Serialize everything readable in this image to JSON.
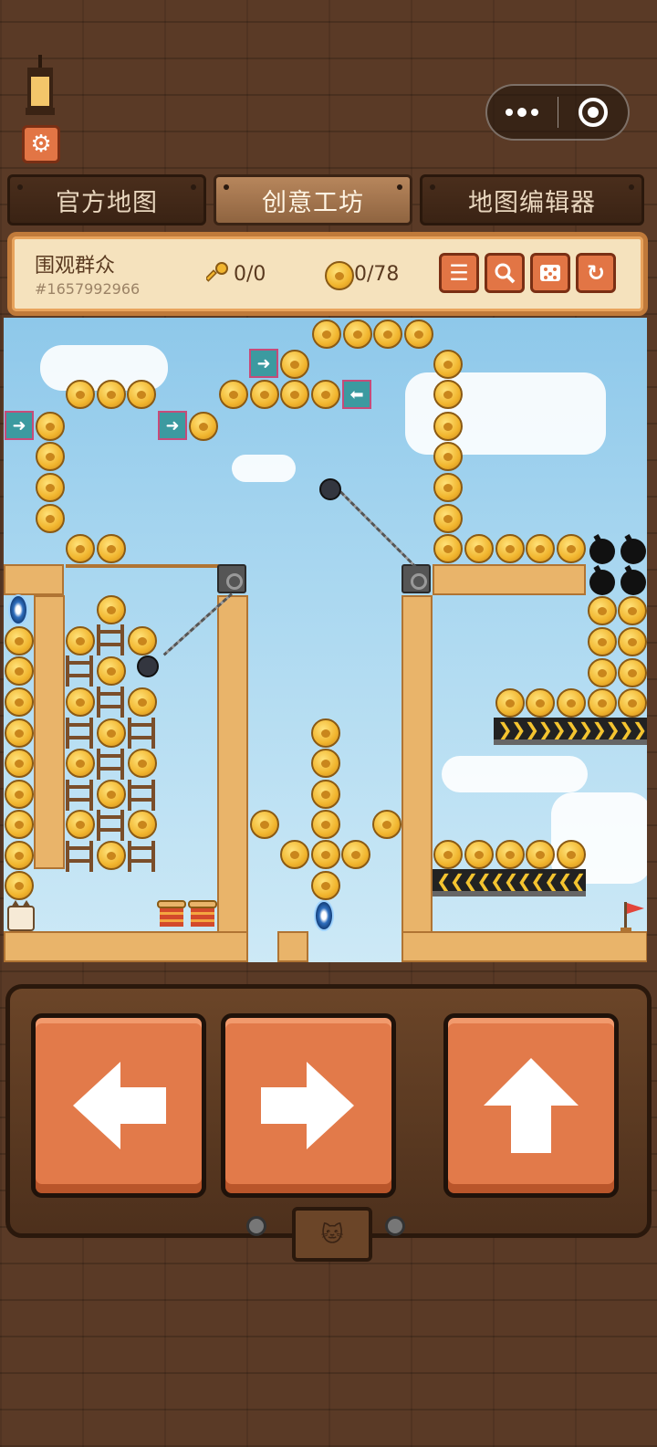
{
  "tabs": [
    {
      "label": "官方地图",
      "active": false
    },
    {
      "label": "创意工坊",
      "active": true
    },
    {
      "label": "地图编辑器",
      "active": false
    }
  ],
  "map": {
    "name": "围观群众",
    "id": "#1657992966",
    "keys": "0/0",
    "coins": "0/78"
  },
  "toolbar": [
    "list-icon",
    "search-icon",
    "dice-icon",
    "refresh-icon"
  ],
  "controls": [
    "left-arrow-icon",
    "right-arrow-icon",
    "up-arrow-icon"
  ],
  "colors": {
    "accent": "#e27545",
    "wood_dark": "#3a2314",
    "sky": "#a9d7f0",
    "coin": "#f1b52e",
    "block": "#e9b46a"
  }
}
